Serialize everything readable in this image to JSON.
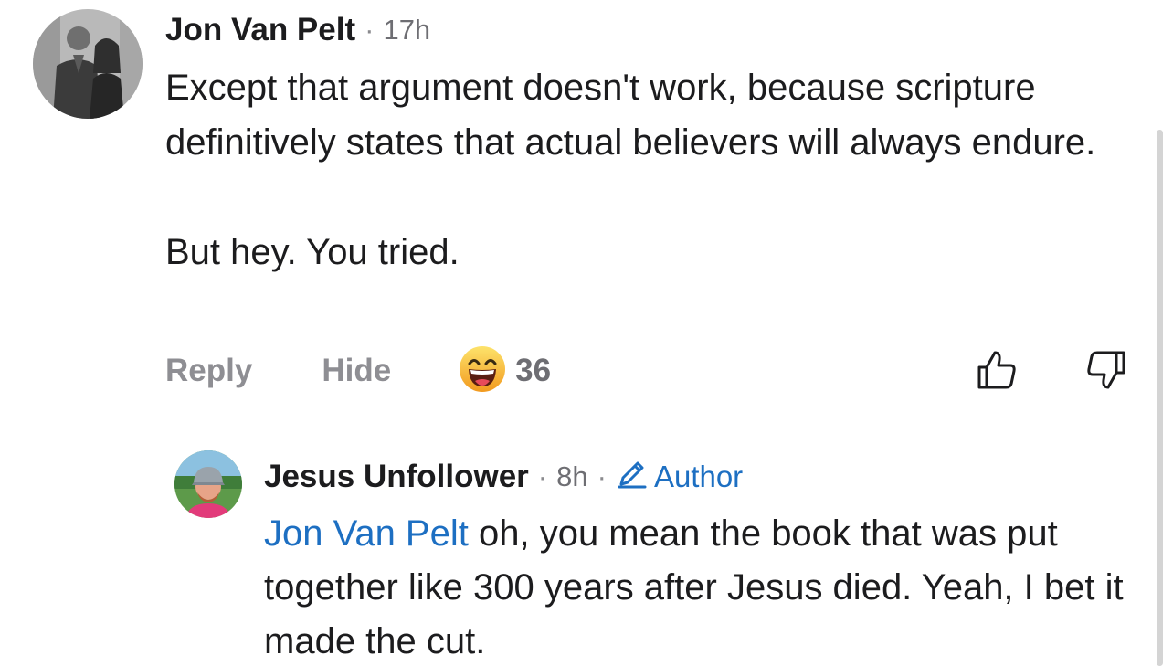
{
  "comment": {
    "author": "Jon Van Pelt",
    "separator": "·",
    "time": "17h",
    "body": [
      "Except that argument doesn't work, because scripture definitively states that actual believers will always endure.",
      "But hey. You tried."
    ],
    "actions": {
      "reply_label": "Reply",
      "hide_label": "Hide",
      "reaction_icon": "grinning-emoji-icon",
      "reaction_count": "36",
      "like_icon": "thumbs-up-icon",
      "dislike_icon": "thumbs-down-icon"
    }
  },
  "reply": {
    "author": "Jesus Unfollower",
    "separator": "·",
    "time": "8h",
    "separator2": "·",
    "badge_icon": "pencil-icon",
    "badge_label": "Author",
    "mention": "Jon Van Pelt",
    "text": " oh, you mean the book that was put together like 300 years after Jesus died. Yeah, I bet it made the cut."
  },
  "colors": {
    "link_blue": "#1d6fc2",
    "muted_gray": "#8e8e93",
    "text": "#1c1c1e",
    "emoji_yellow": "#f7b733"
  }
}
